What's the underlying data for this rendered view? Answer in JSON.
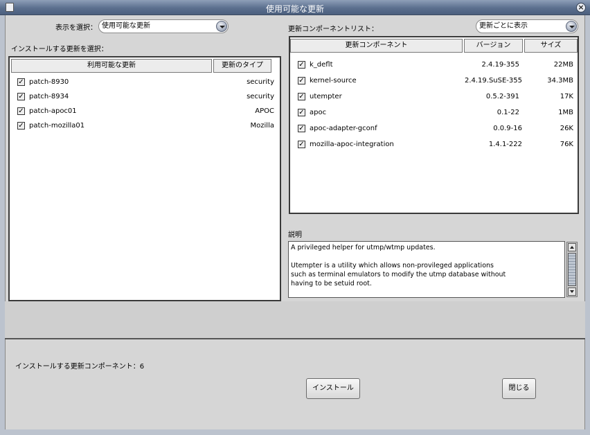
{
  "window": {
    "title": "使用可能な更新"
  },
  "left": {
    "view_label": "表示を選択：",
    "view_value": "使用可能な更新",
    "select_label": "インストールする更新を選択：",
    "columns": [
      "利用可能な更新",
      "更新のタイプ"
    ],
    "rows": [
      {
        "name": "patch-8930",
        "type": "security",
        "checked": "✓"
      },
      {
        "name": "patch-8934",
        "type": "security",
        "checked": "✓"
      },
      {
        "name": "patch-apoc01",
        "type": "APOC",
        "checked": "✓"
      },
      {
        "name": "patch-mozilla01",
        "type": "Mozilla",
        "checked": "✓"
      }
    ]
  },
  "right": {
    "list_label": "更新コンポーネントリスト：",
    "view_value": "更新ごとに表示",
    "columns": [
      "更新コンポーネント",
      "バージョン",
      "サイズ"
    ],
    "rows": [
      {
        "name": "k_deflt",
        "version": "2.4.19-355",
        "size": "22MB",
        "checked": "✓"
      },
      {
        "name": "kernel-source",
        "version": "2.4.19.SuSE-355",
        "size": "34.3MB",
        "checked": "✓"
      },
      {
        "name": "utempter",
        "version": "0.5.2-391",
        "size": "17K",
        "checked": "✓"
      },
      {
        "name": "apoc",
        "version": "0.1-22",
        "size": "1MB",
        "checked": "✓"
      },
      {
        "name": "apoc-adapter-gconf",
        "version": "0.0.9-16",
        "size": "26K",
        "checked": "✓"
      },
      {
        "name": "mozilla-apoc-integration",
        "version": "1.4.1-222",
        "size": "76K",
        "checked": "✓"
      }
    ],
    "desc_label": "説明",
    "description": "A privileged helper for utmp/wtmp updates.\n\nUtempter is a utility which allows non-provileged applications\nsuch as terminal emulators to modify the utmp database without\nhaving to be setuid root."
  },
  "footer": {
    "count_label": "インストールする更新コンポーネント：6",
    "install_label": "インストール",
    "close_label": "閉じる"
  }
}
